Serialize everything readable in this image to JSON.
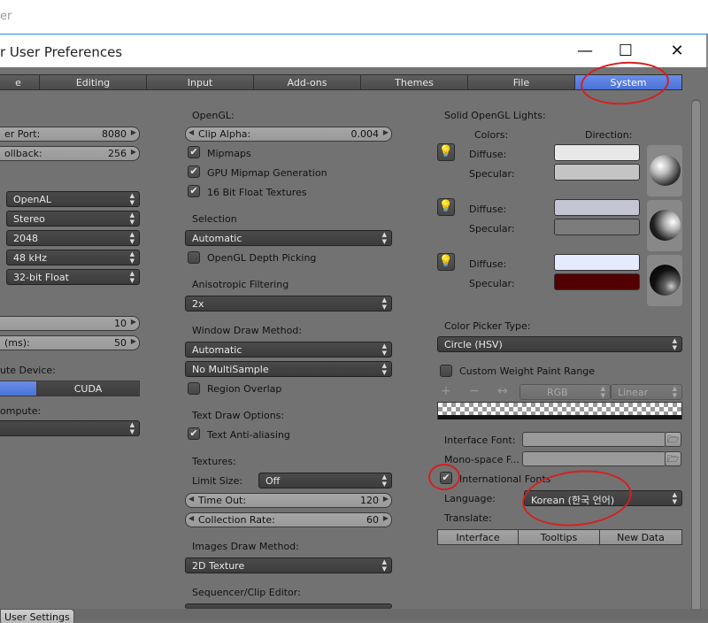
{
  "background_window": {
    "title_fragment": "er"
  },
  "window": {
    "title": "r User Preferences",
    "controls": {
      "minimize": "—",
      "maximize": "☐",
      "close": "✕"
    }
  },
  "tabs": [
    {
      "label": "e"
    },
    {
      "label": "Editing"
    },
    {
      "label": "Input"
    },
    {
      "label": "Add-ons"
    },
    {
      "label": "Themes"
    },
    {
      "label": "File"
    },
    {
      "label": "System",
      "active": true
    }
  ],
  "left_column": {
    "server_port": {
      "label": "er Port:",
      "value": "8080"
    },
    "rollback": {
      "label": "ollback:",
      "value": "256"
    },
    "audio_device": "OpenAL",
    "channels": "Stereo",
    "mixing_buffer": "2048",
    "sample_rate": "48 kHz",
    "sample_format": "32-bit Float",
    "field_a": {
      "label": "",
      "value": "10"
    },
    "field_b": {
      "label": "(ms):",
      "value": "50"
    },
    "compute_device_label": "ute Device:",
    "compute_none": "",
    "compute_cuda": "CUDA",
    "compute_label": "ompute:",
    "compute_select": ""
  },
  "mid_column": {
    "opengl_header": "OpenGL:",
    "clip_alpha": {
      "label": "Clip Alpha:",
      "value": "0.004"
    },
    "mipmaps": "Mipmaps",
    "gpu_mipmap": "GPU Mipmap Generation",
    "float_textures": "16 Bit Float Textures",
    "selection_header": "Selection",
    "selection_value": "Automatic",
    "depth_picking": "OpenGL Depth Picking",
    "aniso_header": "Anisotropic Filtering",
    "aniso_value": "2x",
    "wdm_header": "Window Draw Method:",
    "wdm_value": "Automatic",
    "multisample_value": "No MultiSample",
    "region_overlap": "Region Overlap",
    "text_draw_header": "Text Draw Options:",
    "text_antialias": "Text Anti-aliasing",
    "textures_header": "Textures:",
    "limit_size_label": "Limit Size:",
    "limit_size_value": "Off",
    "time_out": {
      "label": "Time Out:",
      "value": "120"
    },
    "collection_rate": {
      "label": "Collection Rate:",
      "value": "60"
    },
    "images_draw_header": "Images Draw Method:",
    "images_draw_value": "2D Texture",
    "sequencer_header": "Sequencer/Clip Editor:"
  },
  "right_column": {
    "lights_header": "Solid OpenGL Lights:",
    "colors_header": "Colors:",
    "direction_header": "Direction:",
    "lights": [
      {
        "diffuse_label": "Diffuse:",
        "specular_label": "Specular:",
        "diffuse_color": "#e8e8e8",
        "specular_color": "#c4c4c4"
      },
      {
        "diffuse_label": "Diffuse:",
        "specular_label": "Specular:",
        "diffuse_color": "#c4c4d2",
        "specular_color": "#7c7c7c"
      },
      {
        "diffuse_label": "Diffuse:",
        "specular_label": "Specular:",
        "diffuse_color": "#e6eaff",
        "specular_color": "#520000"
      }
    ],
    "color_picker_label": "Color Picker Type:",
    "color_picker_value": "Circle (HSV)",
    "custom_weight": "Custom Weight Paint Range",
    "ramp_plus": "+",
    "ramp_minus": "−",
    "ramp_flip": "↔",
    "ramp_mode": "RGB",
    "ramp_interp": "Linear",
    "interface_font_label": "Interface Font:",
    "mono_font_label": "Mono-space F...",
    "international_fonts": "International Fonts",
    "language_label": "Language:",
    "language_value": "Korean (한국 언어)",
    "translate_label": "Translate:",
    "translate_buttons": [
      "Interface",
      "Tooltips",
      "New Data"
    ]
  },
  "footer": {
    "user_settings": "User Settings"
  },
  "colors": {
    "accent_tab": "#5a7fe0",
    "annotation": "#d42020",
    "panel_bg": "#727272"
  }
}
